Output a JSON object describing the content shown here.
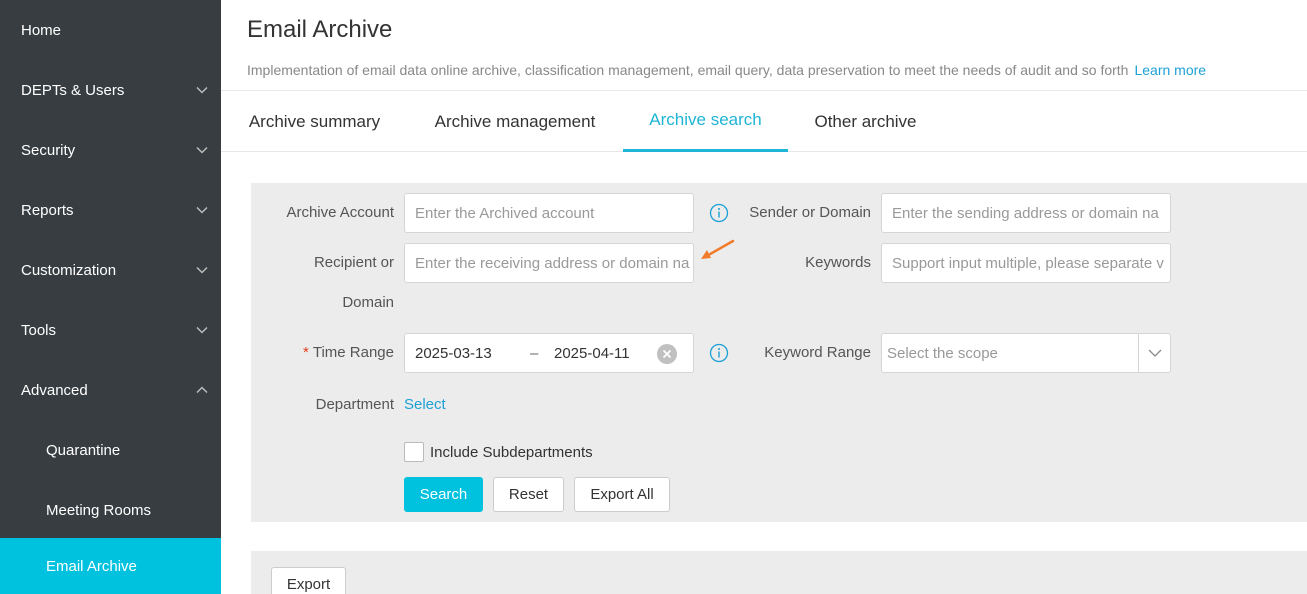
{
  "sidebar": {
    "items": [
      {
        "label": "Home"
      },
      {
        "label": "DEPTs & Users"
      },
      {
        "label": "Security"
      },
      {
        "label": "Reports"
      },
      {
        "label": "Customization"
      },
      {
        "label": "Tools"
      },
      {
        "label": "Advanced"
      },
      {
        "label": "Quarantine"
      },
      {
        "label": "Meeting Rooms"
      },
      {
        "label": "Email Archive"
      }
    ]
  },
  "header": {
    "title": "Email Archive",
    "description": "Implementation of email data online archive, classification management, email query, data preservation to meet the needs of audit and so forth",
    "learn_more": "Learn more"
  },
  "tabs": [
    {
      "label": "Archive summary"
    },
    {
      "label": "Archive management"
    },
    {
      "label": "Archive search"
    },
    {
      "label": "Other archive"
    }
  ],
  "search": {
    "archive_account_label": "Archive Account",
    "archive_account_placeholder": "Enter the Archived account",
    "sender_label": "Sender or Domain",
    "sender_placeholder": "Enter the sending address or domain na",
    "recipient_label_1": "Recipient or",
    "recipient_label_2": "Domain",
    "recipient_placeholder": "Enter the receiving address or domain na",
    "keywords_label": "Keywords",
    "keywords_placeholder": "Support input multiple, please separate v",
    "required_mark": "*",
    "time_range_label": "Time Range",
    "time_start": "2025-03-13",
    "time_sep": "–",
    "time_end": "2025-04-11",
    "keyword_range_label": "Keyword Range",
    "keyword_range_placeholder": "Select the scope",
    "department_label": "Department",
    "department_select": "Select",
    "include_subdepartments": "Include Subdepartments",
    "search_button": "Search",
    "reset_button": "Reset",
    "export_all_button": "Export All"
  },
  "results": {
    "export_button": "Export"
  },
  "colors": {
    "sidebar_bg": "#373d41",
    "accent": "#00c1de",
    "link": "#1da1d6",
    "annotation_arrow": "#f07b2a"
  }
}
